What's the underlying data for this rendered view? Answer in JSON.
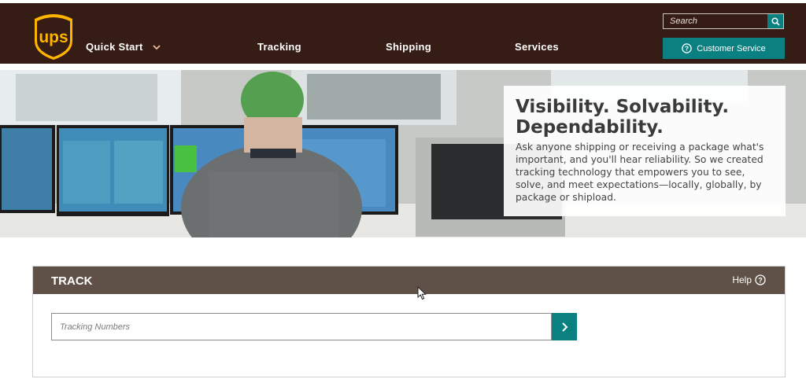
{
  "header": {
    "logo_text": "ups",
    "nav": {
      "quick_start": "Quick Start",
      "tracking": "Tracking",
      "shipping": "Shipping",
      "services": "Services"
    },
    "search": {
      "placeholder": "Search",
      "icon": "search-icon"
    },
    "customer_service": {
      "label": "Customer Service",
      "icon": "help-circle-icon"
    }
  },
  "hero": {
    "title": "Visibility. Solvability. Dependability.",
    "body": "Ask anyone shipping or receiving a package what's important, and you'll hear reliability. So we created tracking technology that empowers you to see, solve, and meet expectations—locally, globally, by package or shipload."
  },
  "track": {
    "title": "TRACK",
    "help_label": "Help",
    "input_placeholder": "Tracking Numbers",
    "submit_icon": "chevron-right-icon"
  },
  "colors": {
    "header_bg": "#351c15",
    "accent_teal": "#0a8080",
    "track_header_bg": "#5f5147",
    "logo_gold": "#ffb500"
  }
}
